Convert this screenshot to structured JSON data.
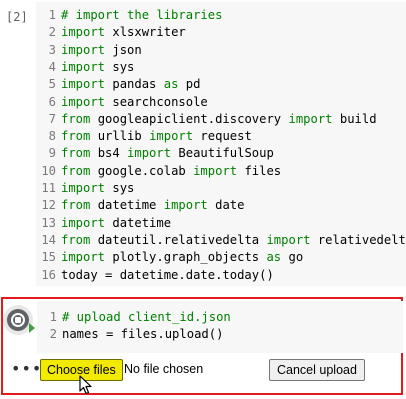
{
  "cell1": {
    "exec_count": "[2]",
    "lines": [
      {
        "num": "1",
        "parts": [
          {
            "t": "cm",
            "s": "# import the libraries"
          }
        ]
      },
      {
        "num": "2",
        "parts": [
          {
            "t": "kw",
            "s": "import"
          },
          {
            "t": "tx",
            "s": " xlsxwriter"
          }
        ]
      },
      {
        "num": "3",
        "parts": [
          {
            "t": "kw",
            "s": "import"
          },
          {
            "t": "tx",
            "s": " json"
          }
        ]
      },
      {
        "num": "4",
        "parts": [
          {
            "t": "kw",
            "s": "import"
          },
          {
            "t": "tx",
            "s": " sys"
          }
        ]
      },
      {
        "num": "5",
        "parts": [
          {
            "t": "kw",
            "s": "import"
          },
          {
            "t": "tx",
            "s": " pandas "
          },
          {
            "t": "kw",
            "s": "as"
          },
          {
            "t": "tx",
            "s": " pd"
          }
        ]
      },
      {
        "num": "6",
        "parts": [
          {
            "t": "kw",
            "s": "import"
          },
          {
            "t": "tx",
            "s": " searchconsole"
          }
        ]
      },
      {
        "num": "7",
        "parts": [
          {
            "t": "kw",
            "s": "from"
          },
          {
            "t": "tx",
            "s": " googleapiclient.discovery "
          },
          {
            "t": "kw",
            "s": "import"
          },
          {
            "t": "tx",
            "s": " build"
          }
        ]
      },
      {
        "num": "8",
        "parts": [
          {
            "t": "kw",
            "s": "from"
          },
          {
            "t": "tx",
            "s": " urllib "
          },
          {
            "t": "kw",
            "s": "import"
          },
          {
            "t": "tx",
            "s": " request"
          }
        ]
      },
      {
        "num": "9",
        "parts": [
          {
            "t": "kw",
            "s": "from"
          },
          {
            "t": "tx",
            "s": " bs4 "
          },
          {
            "t": "kw",
            "s": "import"
          },
          {
            "t": "tx",
            "s": " BeautifulSoup"
          }
        ]
      },
      {
        "num": "10",
        "parts": [
          {
            "t": "kw",
            "s": "from"
          },
          {
            "t": "tx",
            "s": " google.colab "
          },
          {
            "t": "kw",
            "s": "import"
          },
          {
            "t": "tx",
            "s": " files"
          }
        ]
      },
      {
        "num": "11",
        "parts": [
          {
            "t": "kw",
            "s": "import"
          },
          {
            "t": "tx",
            "s": " sys"
          }
        ]
      },
      {
        "num": "12",
        "parts": [
          {
            "t": "kw",
            "s": "from"
          },
          {
            "t": "tx",
            "s": " datetime "
          },
          {
            "t": "kw",
            "s": "import"
          },
          {
            "t": "tx",
            "s": " date"
          }
        ]
      },
      {
        "num": "13",
        "parts": [
          {
            "t": "kw",
            "s": "import"
          },
          {
            "t": "tx",
            "s": " datetime"
          }
        ]
      },
      {
        "num": "14",
        "parts": [
          {
            "t": "kw",
            "s": "from"
          },
          {
            "t": "tx",
            "s": " dateutil.relativedelta "
          },
          {
            "t": "kw",
            "s": "import"
          },
          {
            "t": "tx",
            "s": " relativedelta"
          }
        ]
      },
      {
        "num": "15",
        "parts": [
          {
            "t": "kw",
            "s": "import"
          },
          {
            "t": "tx",
            "s": " plotly.graph_objects "
          },
          {
            "t": "kw",
            "s": "as"
          },
          {
            "t": "tx",
            "s": " go"
          }
        ]
      },
      {
        "num": "16",
        "parts": [
          {
            "t": "tx",
            "s": "today = datetime.date.today()"
          }
        ]
      }
    ]
  },
  "cell2": {
    "lines": [
      {
        "num": "1",
        "parts": [
          {
            "t": "cm",
            "s": "# upload client_id.json"
          }
        ]
      },
      {
        "num": "2",
        "parts": [
          {
            "t": "tx",
            "s": "names = files.upload()"
          }
        ]
      }
    ],
    "output": {
      "more": "•••",
      "choose_files": "Choose files",
      "no_file": "No file chosen",
      "cancel_upload": "Cancel upload"
    }
  },
  "colors": {
    "keyword": "#008000",
    "highlight_border": "#e41b1b",
    "choose_button": "#f2ea00",
    "code_bg": "#f7f7f7"
  },
  "icons": {
    "stop": "stop-execution-icon",
    "run_marker": "running-marker-icon",
    "more": "more-horiz-icon",
    "cursor": "mouse-cursor-icon"
  }
}
